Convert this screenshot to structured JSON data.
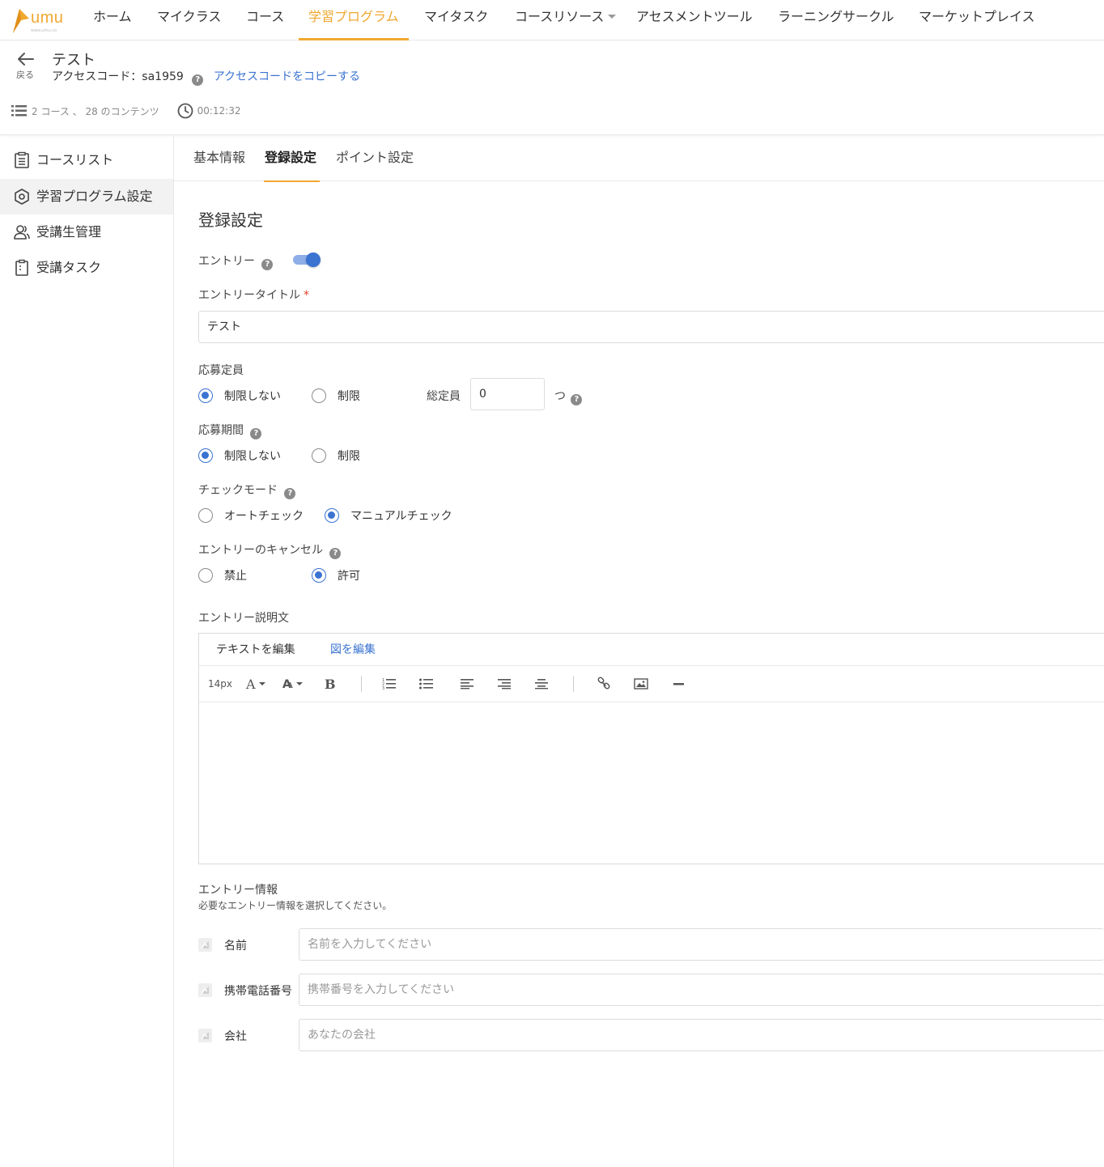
{
  "nav": {
    "logo_text": "umu",
    "logo_sub": "www.umu.co",
    "items": [
      {
        "label": "ホーム"
      },
      {
        "label": "マイクラス"
      },
      {
        "label": "コース"
      },
      {
        "label": "学習プログラム"
      },
      {
        "label": "マイタスク"
      },
      {
        "label": "コースリソース"
      },
      {
        "label": "アセスメントツール"
      },
      {
        "label": "ラーニングサークル"
      },
      {
        "label": "マーケットプレイス"
      }
    ],
    "active_index": 3
  },
  "header": {
    "back_label": "戻る",
    "title": "テスト",
    "access_code_label": "アクセスコード：sa1959",
    "copy_link": "アクセスコードをコピーする",
    "meta_courses": "2 コース 、 28 のコンテンツ",
    "meta_time": "00:12:32"
  },
  "sidebar": {
    "items": [
      {
        "label": "コースリスト",
        "icon": "list-icon"
      },
      {
        "label": "学習プログラム設定",
        "icon": "settings-icon"
      },
      {
        "label": "受講生管理",
        "icon": "users-icon"
      },
      {
        "label": "受講タスク",
        "icon": "clipboard-icon"
      }
    ],
    "active_index": 1
  },
  "tabs": {
    "items": [
      {
        "label": "基本情報"
      },
      {
        "label": "登録設定"
      },
      {
        "label": "ポイント設定"
      }
    ],
    "active_index": 1
  },
  "form": {
    "section_title": "登録設定",
    "entry": {
      "label": "エントリー",
      "enabled": true
    },
    "entry_title": {
      "label": "エントリータイトル",
      "required_mark": "*",
      "value": "テスト"
    },
    "capacity": {
      "label": "応募定員",
      "options": [
        "制限しない",
        "制限"
      ],
      "selected": "制限しない",
      "total_label": "総定員",
      "total_value": "0",
      "unit": "つ"
    },
    "period": {
      "label": "応募期間",
      "options": [
        "制限しない",
        "制限"
      ],
      "selected": "制限しない"
    },
    "check_mode": {
      "label": "チェックモード",
      "options": [
        "オートチェック",
        "マニュアルチェック"
      ],
      "selected": "マニュアルチェック"
    },
    "cancel": {
      "label": "エントリーのキャンセル",
      "options": [
        "禁止",
        "許可"
      ],
      "selected": "許可"
    },
    "description": {
      "label": "エントリー説明文",
      "editor_tab_text": "テキストを編集",
      "editor_tab_image": "図を編集",
      "font_size": "14px"
    },
    "entry_info": {
      "label": "エントリー情報",
      "sub": "必要なエントリー情報を選択してください。",
      "fields": [
        {
          "label": "名前",
          "placeholder": "名前を入力してください"
        },
        {
          "label": "携帯電話番号",
          "placeholder": "携帯番号を入力してください"
        },
        {
          "label": "会社",
          "placeholder": "あなたの会社"
        }
      ]
    }
  },
  "colors": {
    "accent": "#f0a830",
    "primary": "#3b73d1",
    "required": "#e0452b"
  }
}
